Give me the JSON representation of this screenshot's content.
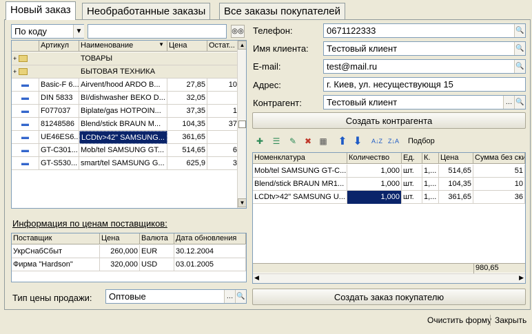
{
  "tabs": [
    {
      "label": "Новый заказ"
    },
    {
      "label": "Необработанные заказы"
    },
    {
      "label": "Все заказы покупателей"
    }
  ],
  "search": {
    "mode": "По коду",
    "value": ""
  },
  "products": {
    "columns": [
      "Артикул",
      "Наименование",
      "Цена",
      "Остат..."
    ],
    "groups": [
      "ТОВАРЫ",
      "БЫТОВАЯ ТЕХНИКА"
    ],
    "rows": [
      {
        "article": "Basic-F 6...",
        "name": "Airvent/hood ARDO B...",
        "price": "27,85",
        "stock": "10"
      },
      {
        "article": "DIN 5833",
        "name": "BI/dishwasher BEKO D...",
        "price": "32,05",
        "stock": ""
      },
      {
        "article": "F077037",
        "name": "Biplate/gas HOTPOIN...",
        "price": "37,35",
        "stock": "1"
      },
      {
        "article": "81248586",
        "name": "Blend/stick BRAUN M...",
        "price": "104,35",
        "stock": "37"
      },
      {
        "article": "UE46ES6...",
        "name": "LCDtv>42\" SAMSUNG...",
        "price": "361,65",
        "stock": ""
      },
      {
        "article": "GT-C301...",
        "name": "Mob/tel SAMSUNG GT...",
        "price": "514,65",
        "stock": "6"
      },
      {
        "article": "GT-S530...",
        "name": "smart/tel SAMSUNG G...",
        "price": "625,9",
        "stock": "3"
      }
    ]
  },
  "supplier_info": {
    "title": "Информация по ценам поставщиков:",
    "columns": [
      "Поставщик",
      "Цена",
      "Валюта",
      "Дата обновления"
    ],
    "rows": [
      {
        "supplier": "УкрСнабСбыт",
        "price": "260,000",
        "currency": "EUR",
        "date": "30.12.2004"
      },
      {
        "supplier": "Фирма \"Hardson\"",
        "price": "320,000",
        "currency": "USD",
        "date": "03.01.2005"
      }
    ]
  },
  "price_type": {
    "label": "Тип цены продажи:",
    "value": "Оптовые"
  },
  "client": {
    "phone_label": "Телефон:",
    "phone": "0671122333",
    "name_label": "Имя клиента:",
    "name": "Тестовый клиент",
    "email_label": "E-mail:",
    "email": "test@mail.ru",
    "address_label": "Адрес:",
    "address": "г. Киев, ул. несуществующя 15",
    "contractor_label": "Контрагент:",
    "contractor": "Тестовый клиент"
  },
  "create_contractor_button": "Создать контрагента",
  "order_toolbar": {
    "pick_label": "Подбор"
  },
  "order": {
    "columns": [
      "Номенклатура",
      "Количество",
      "Ед.",
      "К.",
      "Цена",
      "Сумма без ски"
    ],
    "rows": [
      {
        "name": "Mob/tel SAMSUNG GT-C...",
        "qty": "1,000",
        "unit": "шт.",
        "k": "1,...",
        "price": "514,65",
        "sum": "51"
      },
      {
        "name": "Blend/stick BRAUN MR1...",
        "qty": "1,000",
        "unit": "шт.",
        "k": "1,...",
        "price": "104,35",
        "sum": "10"
      },
      {
        "name": "LCDtv>42\" SAMSUNG U...",
        "qty": "1,000",
        "unit": "шт.",
        "k": "1,...",
        "price": "361,65",
        "sum": "36"
      }
    ],
    "total": "980,65"
  },
  "create_order_button": "Создать заказ покупателю",
  "footer": {
    "clear": "Очистить форму",
    "close": "Закрыть"
  },
  "colors": {
    "selection": "#0a246a",
    "border": "#7f9db9",
    "background": "#ece9d8"
  }
}
